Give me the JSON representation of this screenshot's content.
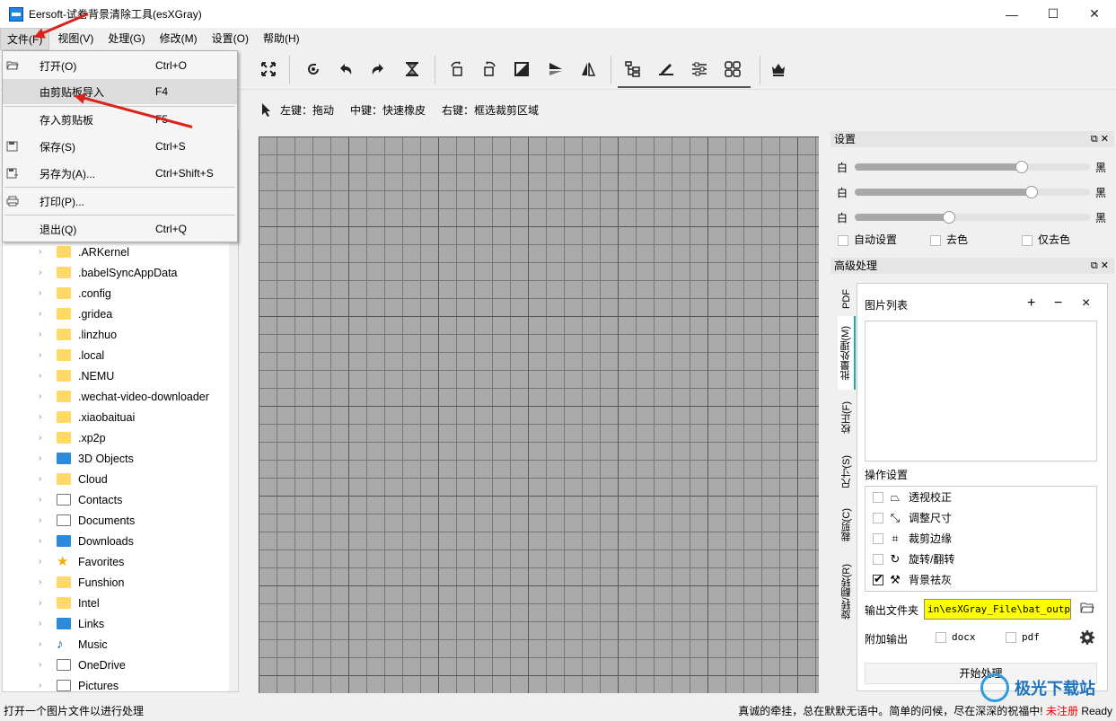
{
  "window": {
    "title": "Eersoft-试卷背景清除工具(esXGray)",
    "min": "—",
    "max": "☐",
    "close": "✕"
  },
  "menubar": [
    {
      "label": "文件(F)"
    },
    {
      "label": "视图(V)"
    },
    {
      "label": "处理(G)"
    },
    {
      "label": "修改(M)"
    },
    {
      "label": "设置(O)"
    },
    {
      "label": "帮助(H)"
    }
  ],
  "hints": {
    "left": "左键：拖动",
    "middle": "中键：快速橡皮",
    "right": "右键：框选裁剪区域"
  },
  "file_menu": {
    "items": [
      {
        "label": "打开(O)",
        "shortcut": "Ctrl+O",
        "icon": "folder-open-icon"
      },
      {
        "label": "由剪贴板导入",
        "shortcut": "F4",
        "icon": ""
      },
      {
        "label": "存入剪贴板",
        "shortcut": "F5",
        "icon": ""
      },
      {
        "label": "保存(S)",
        "shortcut": "Ctrl+S",
        "icon": "save-icon"
      },
      {
        "label": "另存为(A)...",
        "shortcut": "Ctrl+Shift+S",
        "icon": "save-as-icon"
      },
      {
        "label": "打印(P)...",
        "shortcut": "",
        "icon": "printer-icon"
      },
      {
        "label": "退出(Q)",
        "shortcut": "Ctrl+Q",
        "icon": ""
      }
    ]
  },
  "tree": {
    "items": [
      {
        "label": ".ARKernel",
        "icon": "folder"
      },
      {
        "label": ".babelSyncAppData",
        "icon": "folder"
      },
      {
        "label": ".config",
        "icon": "folder"
      },
      {
        "label": ".gridea",
        "icon": "folder"
      },
      {
        "label": ".linzhuo",
        "icon": "folder"
      },
      {
        "label": ".local",
        "icon": "folder"
      },
      {
        "label": ".NEMU",
        "icon": "folder"
      },
      {
        "label": ".wechat-video-downloader",
        "icon": "folder"
      },
      {
        "label": ".xiaobaituai",
        "icon": "folder"
      },
      {
        "label": ".xp2p",
        "icon": "folder"
      },
      {
        "label": "3D Objects",
        "icon": "cube"
      },
      {
        "label": "Cloud",
        "icon": "folder"
      },
      {
        "label": "Contacts",
        "icon": "contacts"
      },
      {
        "label": "Documents",
        "icon": "document"
      },
      {
        "label": "Downloads",
        "icon": "download"
      },
      {
        "label": "Favorites",
        "icon": "star"
      },
      {
        "label": "Funshion",
        "icon": "folder"
      },
      {
        "label": "Intel",
        "icon": "folder"
      },
      {
        "label": "Links",
        "icon": "link"
      },
      {
        "label": "Music",
        "icon": "music"
      },
      {
        "label": "OneDrive",
        "icon": "document"
      },
      {
        "label": "Pictures",
        "icon": "pictures"
      }
    ]
  },
  "settings": {
    "title": "设置",
    "sliders": [
      {
        "left": "白",
        "right": "黑",
        "value": 0.71
      },
      {
        "left": "白",
        "right": "黑",
        "value": 0.75
      },
      {
        "left": "白",
        "right": "黑",
        "value": 0.4
      }
    ],
    "checks": [
      {
        "label": "自动设置",
        "checked": false
      },
      {
        "label": "去色",
        "checked": false
      },
      {
        "label": "仅去色",
        "checked": false
      }
    ]
  },
  "advanced": {
    "title": "高级处理",
    "tabs": [
      "PDF",
      "批量处理(M)",
      "校正(F)",
      "尺寸(S)",
      "裁剪(C)",
      "旋转/翻转(R)"
    ],
    "image_list_label": "图片列表",
    "list_btns": {
      "add": "+",
      "remove": "−",
      "clear": "×"
    },
    "ops_label": "操作设置",
    "ops": [
      {
        "label": "透视校正",
        "checked": false,
        "icon": "perspective-icon"
      },
      {
        "label": "调整尺寸",
        "checked": false,
        "icon": "resize-icon"
      },
      {
        "label": "裁剪边缘",
        "checked": false,
        "icon": "crop-icon"
      },
      {
        "label": "旋转/翻转",
        "checked": false,
        "icon": "rotate-icon"
      },
      {
        "label": "背景祛灰",
        "checked": true,
        "icon": "brush-icon"
      }
    ],
    "output_label": "输出文件夹",
    "output_path": "in\\esXGray_File\\bat_output",
    "extra_label": "附加输出",
    "extra": [
      {
        "label": "docx"
      },
      {
        "label": "pdf"
      }
    ],
    "start": "开始处理"
  },
  "status": {
    "left": "打开一个图片文件以进行处理",
    "right": "真诚的牵挂，总在默默无语中。简单的问候，尽在深深的祝福中!",
    "reg": "未注册",
    "ready": "Ready"
  },
  "watermark": "极光下载站",
  "colors": {
    "accent": "#2aa0a0",
    "highlight": "#ffff00",
    "arrow": "#d9231c"
  }
}
